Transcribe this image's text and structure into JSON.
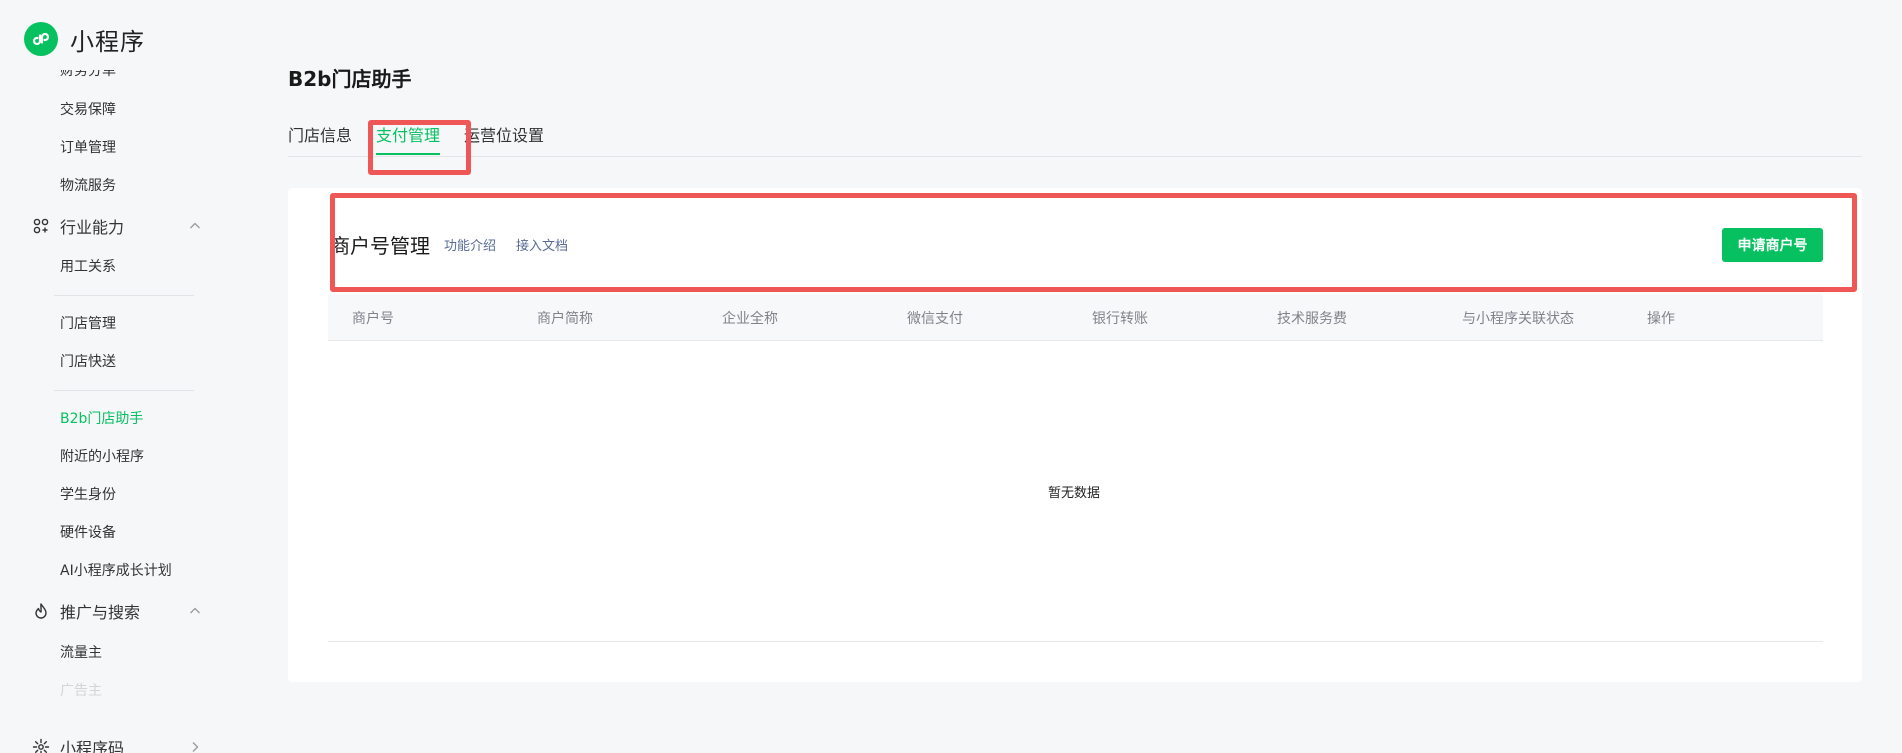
{
  "brand": {
    "name": "小程序",
    "icon": "miniprogram-logo-icon"
  },
  "sidebar": {
    "items": [
      {
        "label": "财务分单"
      },
      {
        "label": "交易保障"
      },
      {
        "label": "订单管理"
      },
      {
        "label": "物流服务"
      },
      {
        "label": "用工关系"
      },
      {
        "label": "门店管理"
      },
      {
        "label": "门店快送"
      },
      {
        "label": "B2b门店助手"
      },
      {
        "label": "附近的小程序"
      },
      {
        "label": "学生身份"
      },
      {
        "label": "硬件设备"
      },
      {
        "label": "AI小程序成长计划"
      },
      {
        "label": "流量主"
      },
      {
        "label": "广告主"
      }
    ],
    "groups": [
      {
        "label": "行业能力",
        "icon": "industry-capability-icon"
      },
      {
        "label": "推广与搜索",
        "icon": "promotion-flame-icon"
      },
      {
        "label": "小程序码",
        "icon": "miniprogram-code-icon"
      }
    ]
  },
  "page": {
    "title": "B2b门店助手"
  },
  "tabs": [
    {
      "label": "门店信息"
    },
    {
      "label": "支付管理"
    },
    {
      "label": "运营位设置"
    }
  ],
  "merchant": {
    "title": "商户号管理",
    "links": [
      "功能介绍",
      "接入文档"
    ],
    "apply_button": "申请商户号"
  },
  "table": {
    "columns": [
      "商户号",
      "商户简称",
      "企业全称",
      "微信支付",
      "银行转账",
      "技术服务费",
      "与小程序关联状态",
      "操作"
    ],
    "rows": [],
    "empty_text": "暂无数据"
  },
  "colors": {
    "accent": "#07c160",
    "link": "#576b95",
    "annotation": "#ef5656"
  }
}
